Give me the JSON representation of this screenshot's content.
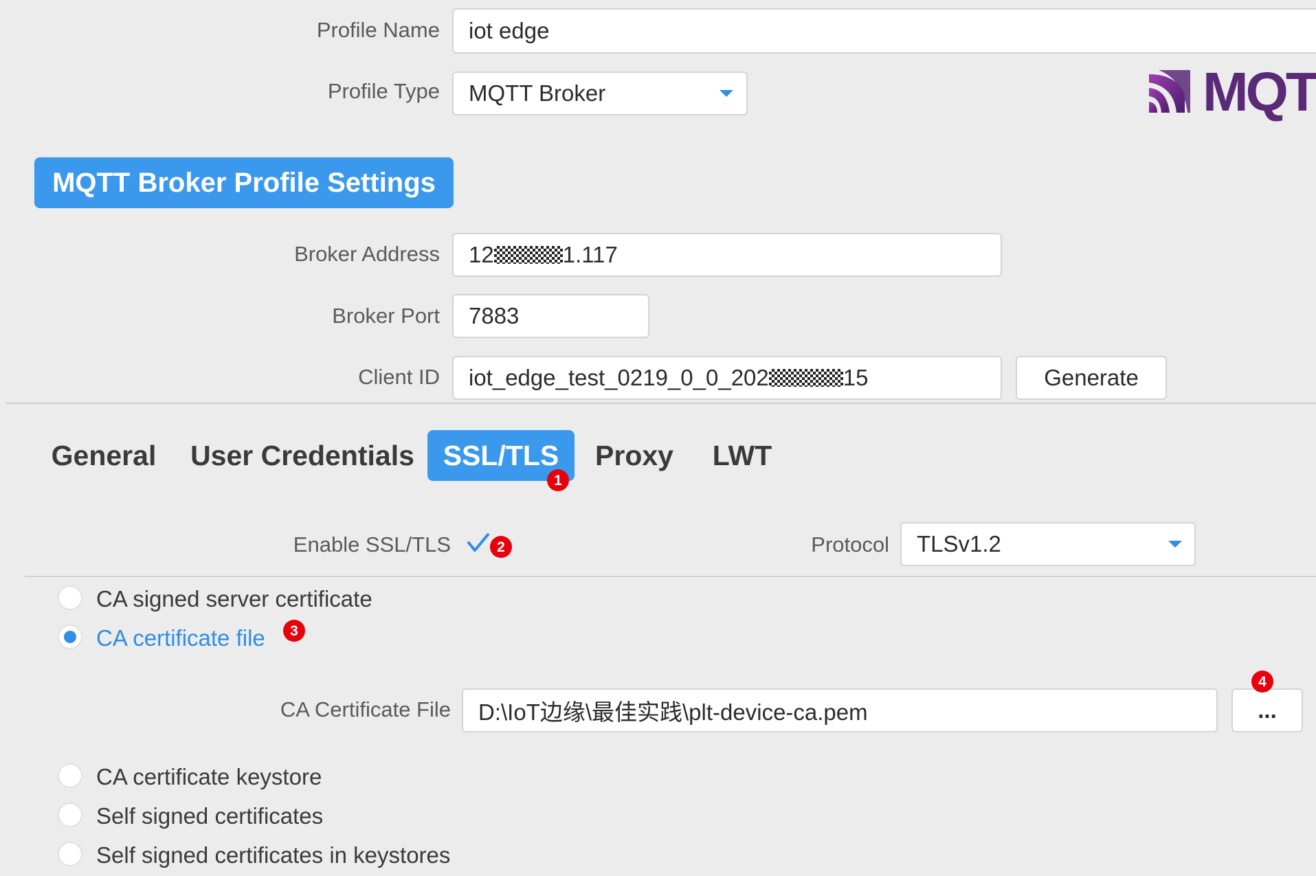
{
  "profile": {
    "name_label": "Profile Name",
    "name_value": "iot edge",
    "type_label": "Profile Type",
    "type_value": "MQTT Broker"
  },
  "logo": {
    "text": "MQT",
    "icon": "mqtt-logo-icon"
  },
  "section_title": "MQTT Broker Profile Settings",
  "broker": {
    "address_label": "Broker Address",
    "address_prefix": "12",
    "address_suffix": "1.117",
    "port_label": "Broker Port",
    "port_value": "7883",
    "client_id_label": "Client ID",
    "client_id_prefix": "iot_edge_test_0219_0_0_202",
    "client_id_suffix": "15",
    "generate_label": "Generate"
  },
  "tabs": [
    {
      "label": "General"
    },
    {
      "label": "User Credentials"
    },
    {
      "label": "SSL/TLS"
    },
    {
      "label": "Proxy"
    },
    {
      "label": "LWT"
    }
  ],
  "active_tab": "SSL/TLS",
  "ssl": {
    "enable_label": "Enable SSL/TLS",
    "enabled": true,
    "protocol_label": "Protocol",
    "protocol_value": "TLSv1.2"
  },
  "cert_options": [
    {
      "label": "CA signed server certificate",
      "selected": false
    },
    {
      "label": "CA certificate file",
      "selected": true
    },
    {
      "label": "CA certificate keystore",
      "selected": false
    },
    {
      "label": "Self signed certificates",
      "selected": false
    },
    {
      "label": "Self signed certificates in keystores",
      "selected": false
    }
  ],
  "ca_file": {
    "label": "CA Certificate File",
    "value": "D:\\IoT边缘\\最佳实践\\plt-device-ca.pem",
    "browse_label": "..."
  },
  "badges": [
    "1",
    "2",
    "3",
    "4"
  ],
  "colors": {
    "accent": "#3a99ec",
    "radio_selected": "#2f8ee5",
    "badge": "#e8000d",
    "background": "#ececec"
  }
}
